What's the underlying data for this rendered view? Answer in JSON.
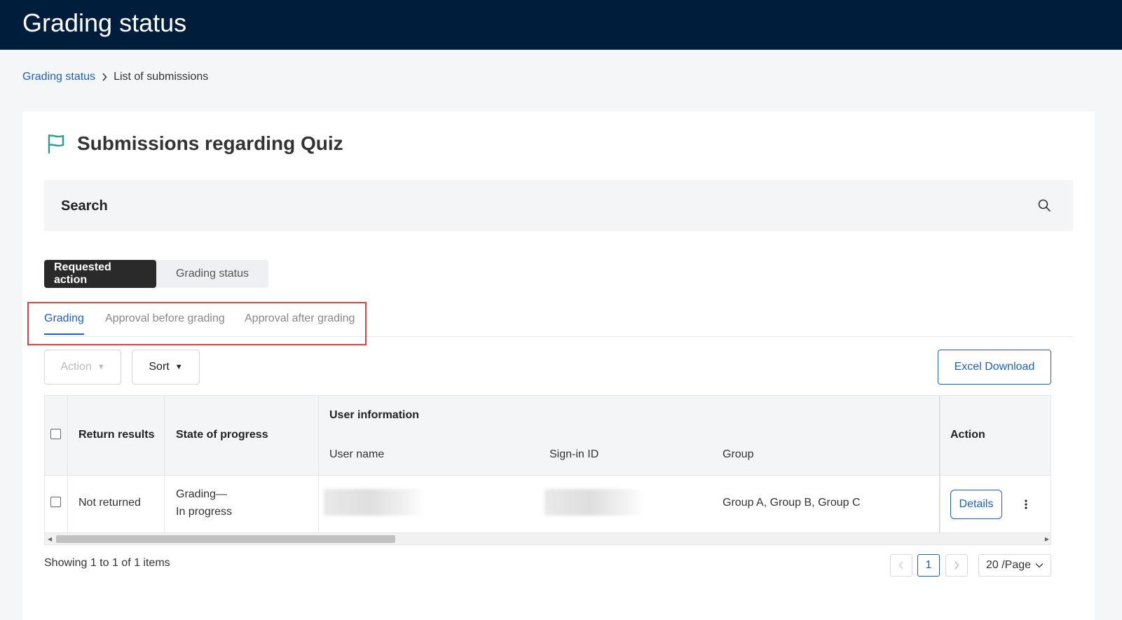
{
  "header": {
    "title": "Grading status"
  },
  "breadcrumb": {
    "link": "Grading status",
    "current": "List of submissions"
  },
  "page": {
    "title": "Submissions regarding Quiz",
    "icon": "flag-icon"
  },
  "search": {
    "label": "Search",
    "icon": "search-icon"
  },
  "segment": {
    "items": [
      {
        "label": "Requested action",
        "active": true
      },
      {
        "label": "Grading status",
        "active": false
      }
    ]
  },
  "subtabs": {
    "items": [
      {
        "label": "Grading",
        "active": true
      },
      {
        "label": "Approval before grading",
        "active": false
      },
      {
        "label": "Approval after grading",
        "active": false
      }
    ]
  },
  "toolbar": {
    "action_label": "Action",
    "sort_label": "Sort",
    "excel_label": "Excel Download"
  },
  "table": {
    "headers": {
      "return_results": "Return results",
      "state_of_progress": "State of progress",
      "user_information": "User information",
      "user_name": "User name",
      "sign_in_id": "Sign-in ID",
      "group": "Group",
      "action": "Action"
    },
    "rows": [
      {
        "return_results": "Not returned",
        "state_line1": "Grading—",
        "state_line2": "In progress",
        "group": "Group A, Group B, Group C",
        "details_label": "Details"
      }
    ]
  },
  "footer": {
    "showing": "Showing 1 to 1 of 1 items",
    "current_page": "1",
    "page_size": "20 /Page"
  },
  "colors": {
    "topbar": "#001e3c",
    "accent": "#1c5fc4",
    "highlight": "#e04040",
    "flag": "#2a9d8f"
  }
}
